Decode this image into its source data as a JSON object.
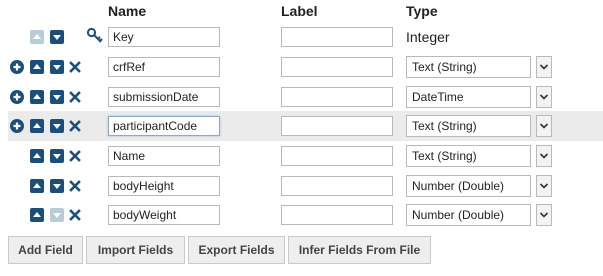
{
  "header": {
    "name": "Name",
    "label": "Label",
    "type": "Type"
  },
  "fields": [
    {
      "name": "Key",
      "label": "",
      "type": "Integer",
      "type_editable": false,
      "is_key": true,
      "can_add": false,
      "can_remove": false,
      "up_enabled": false,
      "down_enabled": true,
      "highlighted": false,
      "focused": false
    },
    {
      "name": "crfRef",
      "label": "",
      "type": "Text (String)",
      "type_editable": true,
      "is_key": false,
      "can_add": true,
      "can_remove": true,
      "up_enabled": true,
      "down_enabled": true,
      "highlighted": false,
      "focused": false
    },
    {
      "name": "submissionDate",
      "label": "",
      "type": "DateTime",
      "type_editable": true,
      "is_key": false,
      "can_add": true,
      "can_remove": true,
      "up_enabled": true,
      "down_enabled": true,
      "highlighted": false,
      "focused": false
    },
    {
      "name": "participantCode",
      "label": "",
      "type": "Text (String)",
      "type_editable": true,
      "is_key": false,
      "can_add": true,
      "can_remove": true,
      "up_enabled": true,
      "down_enabled": true,
      "highlighted": true,
      "focused": true
    },
    {
      "name": "Name",
      "label": "",
      "type": "Text (String)",
      "type_editable": true,
      "is_key": false,
      "can_add": false,
      "can_remove": true,
      "up_enabled": true,
      "down_enabled": true,
      "highlighted": false,
      "focused": false
    },
    {
      "name": "bodyHeight",
      "label": "",
      "type": "Number (Double)",
      "type_editable": true,
      "is_key": false,
      "can_add": false,
      "can_remove": true,
      "up_enabled": true,
      "down_enabled": true,
      "highlighted": false,
      "focused": false
    },
    {
      "name": "bodyWeight",
      "label": "",
      "type": "Number (Double)",
      "type_editable": true,
      "is_key": false,
      "can_add": false,
      "can_remove": true,
      "up_enabled": true,
      "down_enabled": false,
      "highlighted": false,
      "focused": false
    }
  ],
  "buttons": {
    "add_field": "Add Field",
    "import_fields": "Import Fields",
    "export_fields": "Export Fields",
    "infer_fields": "Infer Fields From File"
  },
  "colors": {
    "icon": "#1b4f7a",
    "icon_disabled": "#b7cbd9",
    "row_highlight": "#ebebeb",
    "key_icon": "#1b4f7a"
  }
}
